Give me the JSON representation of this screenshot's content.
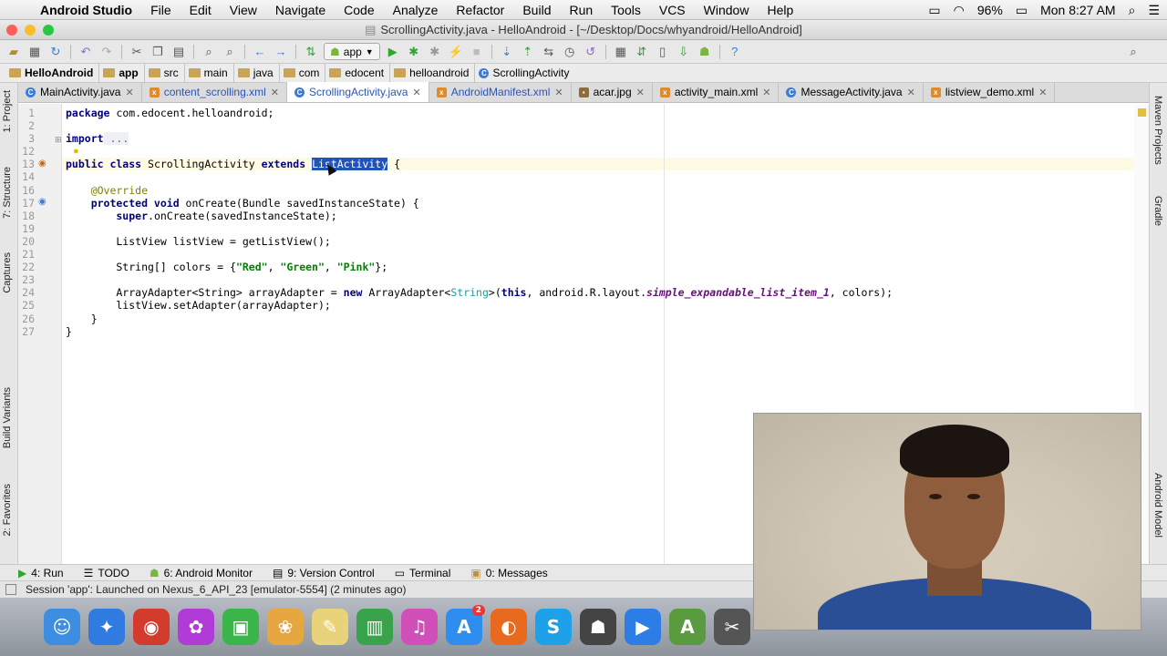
{
  "mac_menu": {
    "app_name": "Android Studio",
    "items": [
      "File",
      "Edit",
      "View",
      "Navigate",
      "Code",
      "Analyze",
      "Refactor",
      "Build",
      "Run",
      "Tools",
      "VCS",
      "Window",
      "Help"
    ],
    "battery": "96%",
    "clock": "Mon 8:27 AM"
  },
  "window": {
    "title": "ScrollingActivity.java - HelloAndroid - [~/Desktop/Docs/whyandroid/HelloAndroid]"
  },
  "toolbar": {
    "run_config": "app"
  },
  "breadcrumb": [
    "HelloAndroid",
    "app",
    "src",
    "main",
    "java",
    "com",
    "edocent",
    "helloandroid",
    "ScrollingActivity"
  ],
  "tabs": [
    {
      "label": "MainActivity.java",
      "icon": "class-icon",
      "color": "#3d7bd9"
    },
    {
      "label": "content_scrolling.xml",
      "icon": "xml-icon",
      "color": "#e08a2e"
    },
    {
      "label": "ScrollingActivity.java",
      "icon": "class-icon",
      "color": "#3d7bd9"
    },
    {
      "label": "AndroidManifest.xml",
      "icon": "xml-icon",
      "color": "#e08a2e"
    },
    {
      "label": "acar.jpg",
      "icon": "image-icon",
      "color": "#8a6d3b"
    },
    {
      "label": "activity_main.xml",
      "icon": "xml-icon",
      "color": "#e08a2e"
    },
    {
      "label": "MessageActivity.java",
      "icon": "class-icon",
      "color": "#3d7bd9"
    },
    {
      "label": "listview_demo.xml",
      "icon": "xml-icon",
      "color": "#e08a2e"
    }
  ],
  "active_tab": "ScrollingActivity.java",
  "left_tool_windows": [
    "1: Project",
    "7: Structure",
    "Captures",
    "Build Variants",
    "2: Favorites"
  ],
  "right_tool_windows": [
    "Maven Projects",
    "Gradle",
    "Android Model"
  ],
  "line_numbers": [
    "1",
    "2",
    "3",
    "12",
    "13",
    "14",
    "16",
    "17",
    "18",
    "19",
    "20",
    "21",
    "22",
    "23",
    "24",
    "25",
    "26",
    "27"
  ],
  "code": {
    "l1_kw": "package",
    "l1_rest": " com.edocent.helloandroid;",
    "l3_kw": "import",
    "l3_rest": " ...",
    "l13_kw1": "public class",
    "l13_name": " ScrollingActivity ",
    "l13_kw2": "extends",
    "l13_sel": "ListActivity",
    "l13_rest": " {",
    "l16_ann": "    @Override",
    "l17_kw": "    protected void",
    "l17_rest": " onCreate(Bundle savedInstanceState) {",
    "l18_kw": "        super",
    "l18_rest": ".onCreate(savedInstanceState);",
    "l20": "        ListView listView = getListView();",
    "l22_a": "        String[] colors = {",
    "l22_s1": "\"Red\"",
    "l22_c1": ", ",
    "l22_s2": "\"Green\"",
    "l22_c2": ", ",
    "l22_s3": "\"Pink\"",
    "l22_end": "};",
    "l24_a": "        ArrayAdapter<String> arrayAdapter = ",
    "l24_new": "new",
    "l24_b": " ArrayAdapter<",
    "l24_gen": "String",
    "l24_c": ">(",
    "l24_this": "this",
    "l24_d": ", android.R.layout.",
    "l24_field": "simple_expandable_list_item_1",
    "l24_e": ", colors);",
    "l25": "        listView.setAdapter(arrayAdapter);",
    "l26": "    }",
    "l27": "}"
  },
  "bottom_tools": [
    {
      "label": "4: Run",
      "icon": "run-icon"
    },
    {
      "label": "TODO",
      "icon": "todo-icon"
    },
    {
      "label": "6: Android Monitor",
      "icon": "android-icon"
    },
    {
      "label": "9: Version Control",
      "icon": "vcs-icon"
    },
    {
      "label": "Terminal",
      "icon": "terminal-icon"
    },
    {
      "label": "0: Messages",
      "icon": "messages-icon"
    }
  ],
  "status": "Session 'app': Launched on Nexus_6_API_23 [emulator-5554] (2 minutes ago)",
  "dock": [
    {
      "name": "finder-icon",
      "glyph": "☺",
      "color": "#3d8de0"
    },
    {
      "name": "safari-icon",
      "glyph": "✦",
      "color": "#2f7be0"
    },
    {
      "name": "chrome-icon",
      "glyph": "◉",
      "color": "#d33b2c"
    },
    {
      "name": "flower-icon",
      "glyph": "✿",
      "color": "#b03bd6"
    },
    {
      "name": "facetime-icon",
      "glyph": "▣",
      "color": "#3bb54a"
    },
    {
      "name": "photos-icon",
      "glyph": "❀",
      "color": "#e6a640"
    },
    {
      "name": "notes-icon",
      "glyph": "✎",
      "color": "#e8d27a"
    },
    {
      "name": "numbers-icon",
      "glyph": "▥",
      "color": "#38a34b"
    },
    {
      "name": "itunes-icon",
      "glyph": "♫",
      "color": "#d04fb8"
    },
    {
      "name": "appstore-icon",
      "glyph": "A",
      "color": "#2d8ef0",
      "badge": "2"
    },
    {
      "name": "firefox-icon",
      "glyph": "◐",
      "color": "#e76a1e"
    },
    {
      "name": "skype-icon",
      "glyph": "S",
      "color": "#1ea1e8"
    },
    {
      "name": "evernote-icon",
      "glyph": "☗",
      "color": "#444"
    },
    {
      "name": "zoom-icon",
      "glyph": "▶",
      "color": "#2d7de6"
    },
    {
      "name": "android-studio-icon",
      "glyph": "A",
      "color": "#5a9b3f"
    },
    {
      "name": "tools-icon",
      "glyph": "✂",
      "color": "#555"
    }
  ]
}
